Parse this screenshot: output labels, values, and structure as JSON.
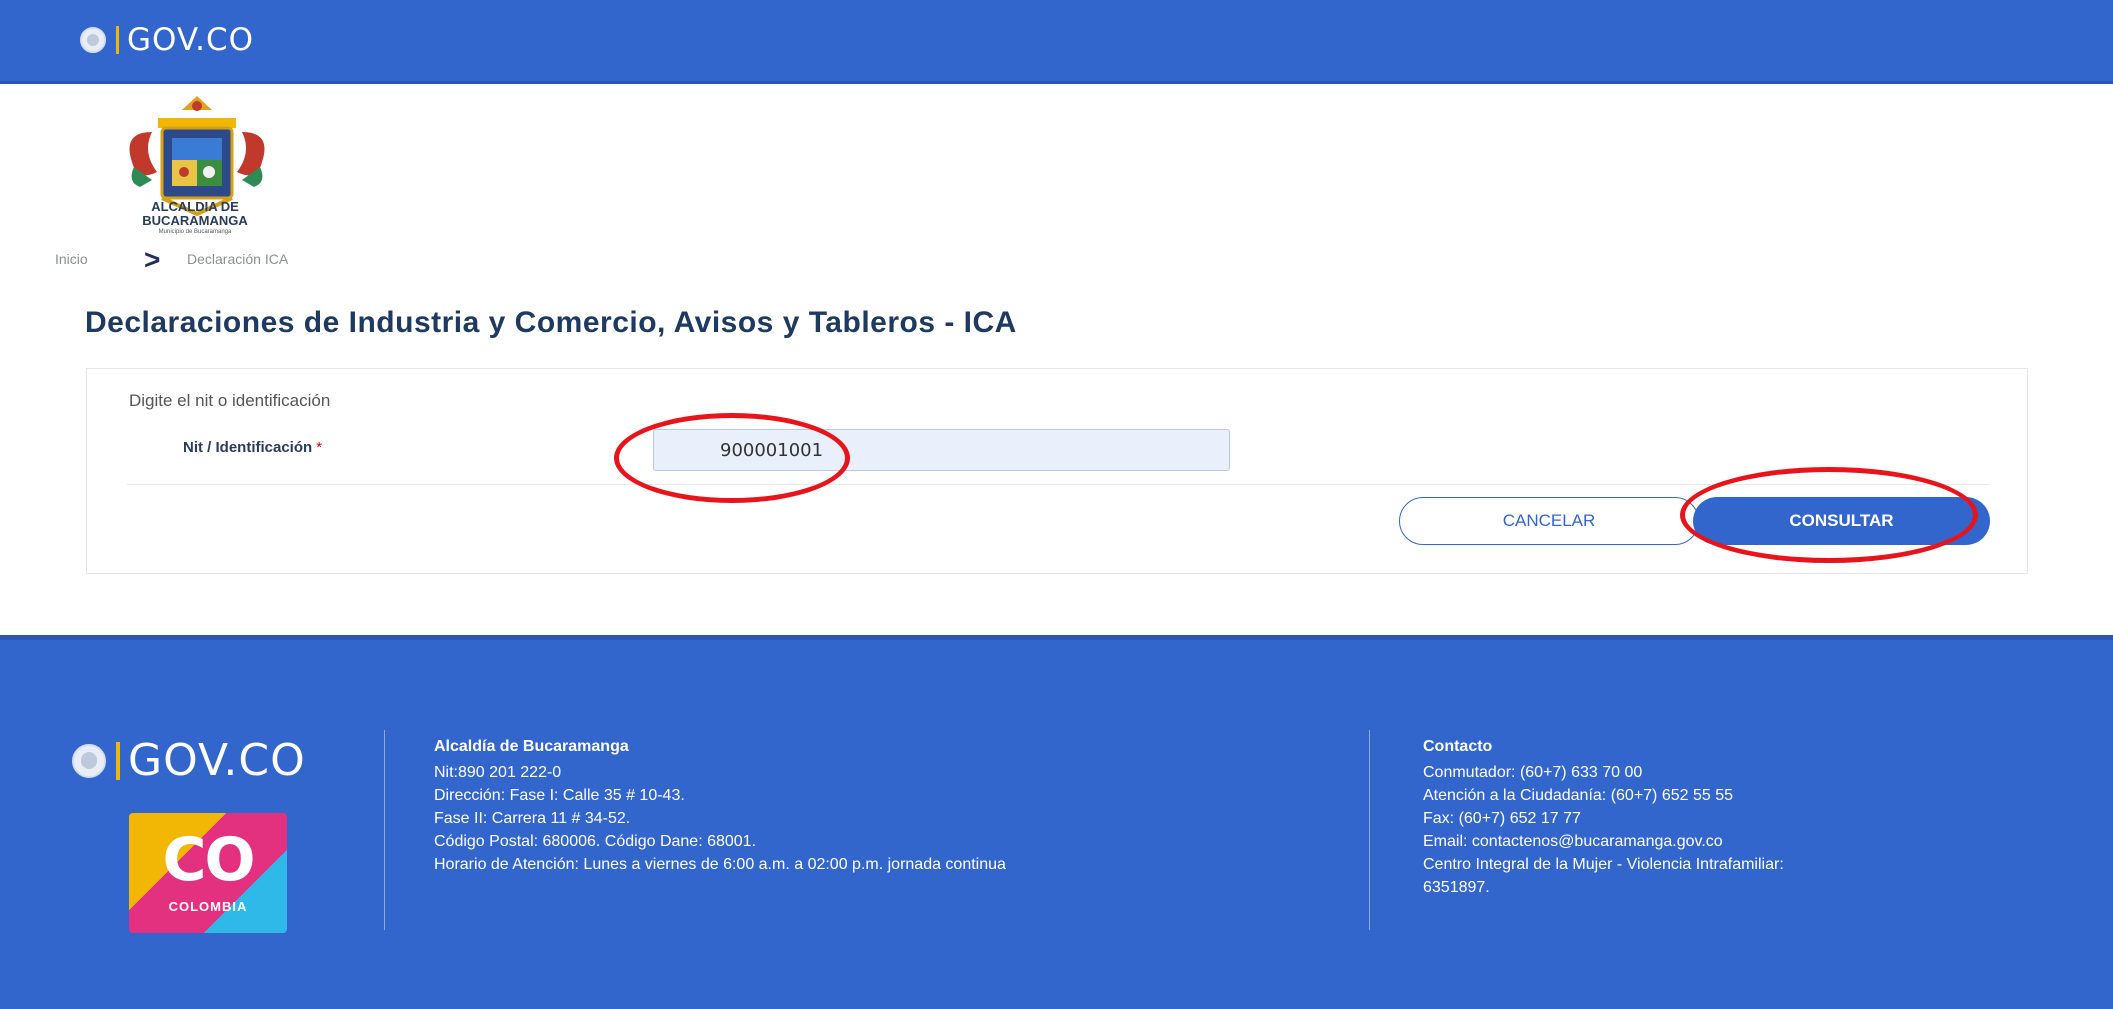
{
  "header": {
    "brand": "GOV.CO"
  },
  "crest": {
    "line1": "ALCALDIA DE",
    "line2": "BUCARAMANGA",
    "line3": "Municipio de Bucaramanga"
  },
  "breadcrumb": {
    "home": "Inicio",
    "separator": ">",
    "current": "Declaración ICA"
  },
  "page_title": "Declaraciones de Industria y Comercio, Avisos y Tableros - ICA",
  "form": {
    "instruction": "Digite el nit o identificación",
    "field_label": "Nit / Identificación",
    "required_mark": "*",
    "nit_value": "900001001",
    "cancel_label": "CANCELAR",
    "submit_label": "CONSULTAR"
  },
  "footer": {
    "brand": "GOV.CO",
    "country_logo": {
      "main": "CO",
      "sub": "COLOMBIA"
    },
    "entity": {
      "title": "Alcaldía de Bucaramanga",
      "lines": [
        "Nit:890 201 222-0",
        "Dirección: Fase I: Calle 35 # 10-43.",
        "Fase II: Carrera 11 # 34-52.",
        "Código Postal: 680006. Código Dane: 68001.",
        "Horario de Atención: Lunes a viernes de 6:00 a.m. a 02:00 p.m. jornada continua"
      ]
    },
    "contact": {
      "title": "Contacto",
      "lines": [
        "Conmutador: (60+7) 633 70 00",
        "Atención a la Ciudadanía: (60+7) 652 55 55",
        "Fax: (60+7) 652 17 77",
        "Email: contactenos@bucaramanga.gov.co",
        "Centro Integral de la Mujer - Violencia Intrafamiliar:",
        "6351897."
      ]
    }
  },
  "colors": {
    "brand_blue": "#3366cc",
    "annotation_red": "#e8141b",
    "title_navy": "#1f3a60"
  }
}
